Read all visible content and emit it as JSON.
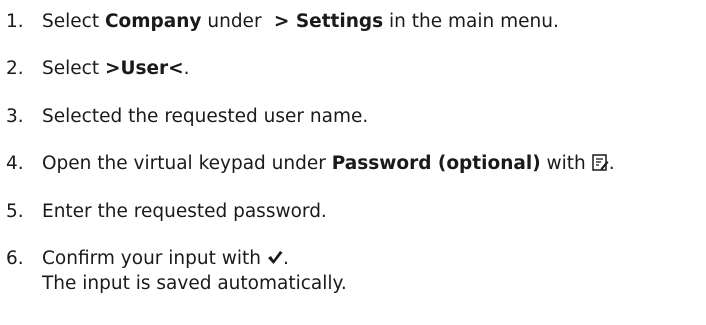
{
  "steps": [
    {
      "number": "1.",
      "pre": "Select ",
      "b1": "Company",
      "mid": " under ",
      "b2": " > Settings",
      "post": " in the main menu."
    },
    {
      "number": "2.",
      "pre": "Select ",
      "b1": ">User<",
      "post": "."
    },
    {
      "number": "3.",
      "text": "Selected the requested user name."
    },
    {
      "number": "4.",
      "pre": "Open the virtual keypad under ",
      "b1": "Password (optional)",
      "mid": " with",
      "icon": "edit-icon",
      "post": "."
    },
    {
      "number": "5.",
      "text": "Enter the requested password."
    },
    {
      "number": "6.",
      "pre": "Confirm your input with",
      "icon": "checkmark-icon",
      "post": ".",
      "line2": "The input is saved automatically."
    }
  ]
}
